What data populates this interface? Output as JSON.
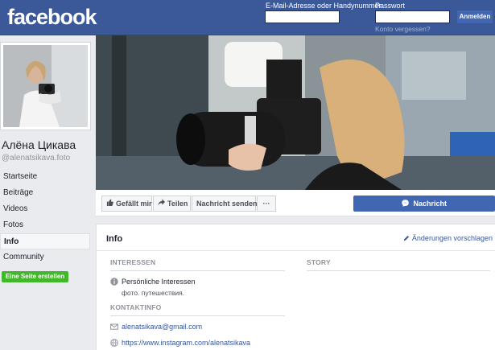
{
  "header": {
    "logo": "facebook",
    "email_label": "E-Mail-Adresse oder Handynummer",
    "password_label": "Passwort",
    "login_button": "Anmelden",
    "forgot_link": "Konto vergessen?"
  },
  "profile": {
    "name": "Алёна Цикава",
    "handle": "@alenatsikava.foto"
  },
  "sidebar": {
    "items": [
      {
        "label": "Startseite",
        "active": false
      },
      {
        "label": "Beiträge",
        "active": false
      },
      {
        "label": "Videos",
        "active": false
      },
      {
        "label": "Fotos",
        "active": false
      },
      {
        "label": "Info",
        "active": true
      },
      {
        "label": "Community",
        "active": false
      }
    ],
    "create_page_button": "Eine Seite erstellen"
  },
  "actions": {
    "like": "Gefällt mir",
    "share": "Teilen",
    "send_message": "Nachricht senden",
    "more": "···",
    "message": "Nachricht"
  },
  "info": {
    "title": "Info",
    "edit_link": "Änderungen vorschlagen",
    "interests_heading": "INTERESSEN",
    "story_heading": "STORY",
    "interests_label": "Persönliche Interessen",
    "interests_value": "фото. путешествия.",
    "contact_heading": "KONTAKTINFO",
    "email": "alenatsikava@gmail.com",
    "website": "https://www.instagram.com/alenatsikava"
  },
  "colors": {
    "brand_blue": "#3b5998",
    "button_blue": "#4267b2",
    "link_blue": "#385898",
    "green": "#42b72a"
  }
}
